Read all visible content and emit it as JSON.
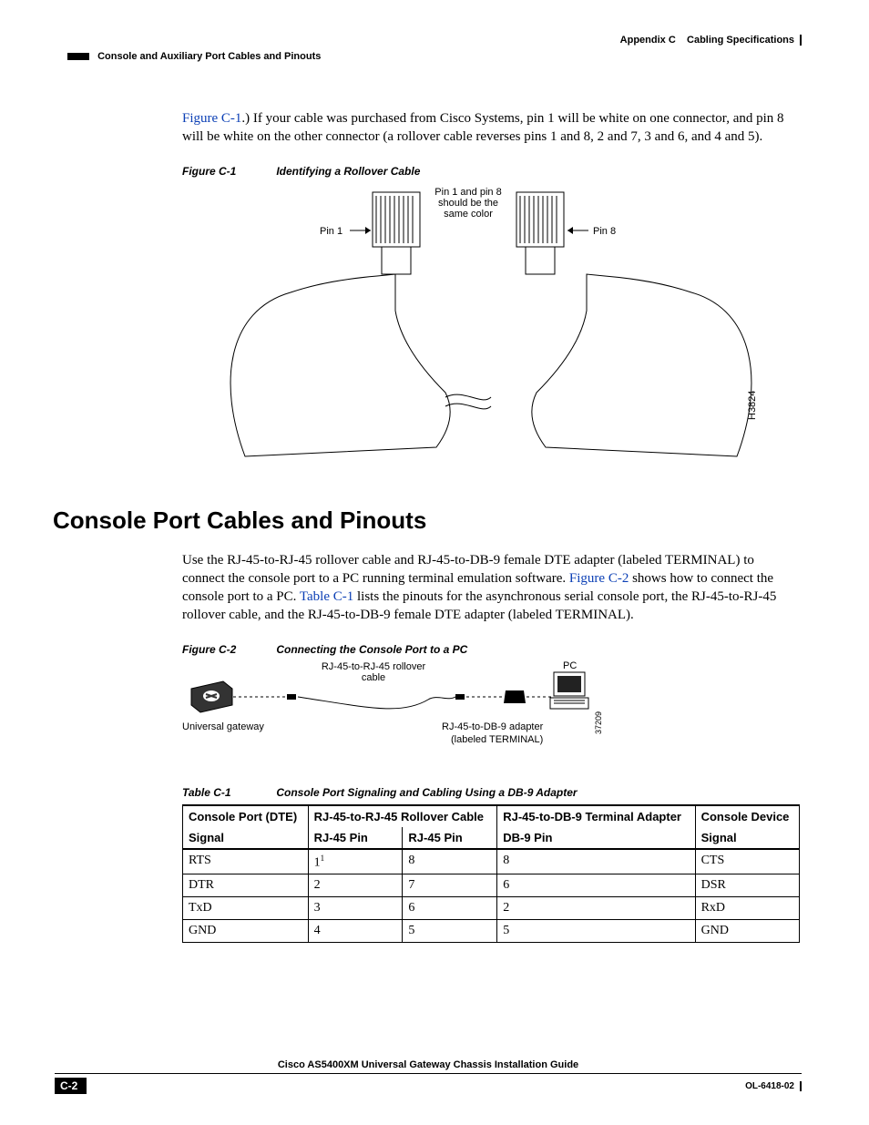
{
  "header": {
    "appendix": "Appendix C",
    "appendix_title": "Cabling Specifications",
    "section": "Console and Auxiliary Port Cables and Pinouts"
  },
  "intro_para": {
    "link_text": "Figure C-1",
    "rest": ".) If your cable was purchased from Cisco Systems, pin 1 will be white on one connector, and pin 8 will be white on the other connector (a rollover cable reverses pins 1 and 8, 2 and 7, 3 and 6, and 4 and 5)."
  },
  "figure_c1": {
    "label": "Figure C-1",
    "title": "Identifying a Rollover Cable",
    "annot_center": "Pin 1 and pin 8 should be the same color",
    "annot_left": "Pin 1",
    "annot_right": "Pin 8",
    "art_id": "H3824"
  },
  "heading": "Console Port Cables and Pinouts",
  "para2": {
    "pre": "Use the RJ-45-to-RJ-45 rollover cable and RJ-45-to-DB-9 female DTE adapter (labeled TERMINAL) to connect the console port to a PC running terminal emulation software. ",
    "link1": "Figure C-2",
    "mid": " shows how to connect the console port to a PC. ",
    "link2": "Table C-1",
    "post": " lists the pinouts for the asynchronous serial console port, the RJ-45-to-RJ-45 rollover cable, and the RJ-45-to-DB-9 female DTE adapter (labeled TERMINAL)."
  },
  "figure_c2": {
    "label": "Figure C-2",
    "title": "Connecting the Console Port to a PC",
    "labels": {
      "gateway": "Universal gateway",
      "cable": "RJ-45-to-RJ-45 rollover cable",
      "adapter_l1": "RJ-45-to-DB-9 adapter",
      "adapter_l2": "(labeled TERMINAL)",
      "pc": "PC",
      "art_id": "37209"
    }
  },
  "table_c1": {
    "label": "Table C-1",
    "title": "Console Port Signaling and Cabling Using a DB-9 Adapter",
    "head": {
      "c1_top": "Console Port (DTE)",
      "c2_top": "RJ-45-to-RJ-45 Rollover Cable",
      "c3_top": "RJ-45-to-DB-9 Terminal Adapter",
      "c4_top": "Console Device",
      "c1_sub": "Signal",
      "c2a_sub": "RJ-45 Pin",
      "c2b_sub": "RJ-45 Pin",
      "c3_sub": "DB-9 Pin",
      "c4_sub": "Signal"
    },
    "rows": [
      {
        "signal_in": "RTS",
        "pin_a": "1",
        "pin_a_note": "1",
        "pin_b": "8",
        "db9": "8",
        "signal_out": "CTS"
      },
      {
        "signal_in": "DTR",
        "pin_a": "2",
        "pin_b": "7",
        "db9": "6",
        "signal_out": "DSR"
      },
      {
        "signal_in": "TxD",
        "pin_a": "3",
        "pin_b": "6",
        "db9": "2",
        "signal_out": "RxD"
      },
      {
        "signal_in": "GND",
        "pin_a": "4",
        "pin_b": "5",
        "db9": "5",
        "signal_out": "GND"
      }
    ]
  },
  "footer": {
    "doc_title": "Cisco AS5400XM Universal Gateway Chassis Installation Guide",
    "page": "C-2",
    "doc_id": "OL-6418-02"
  }
}
